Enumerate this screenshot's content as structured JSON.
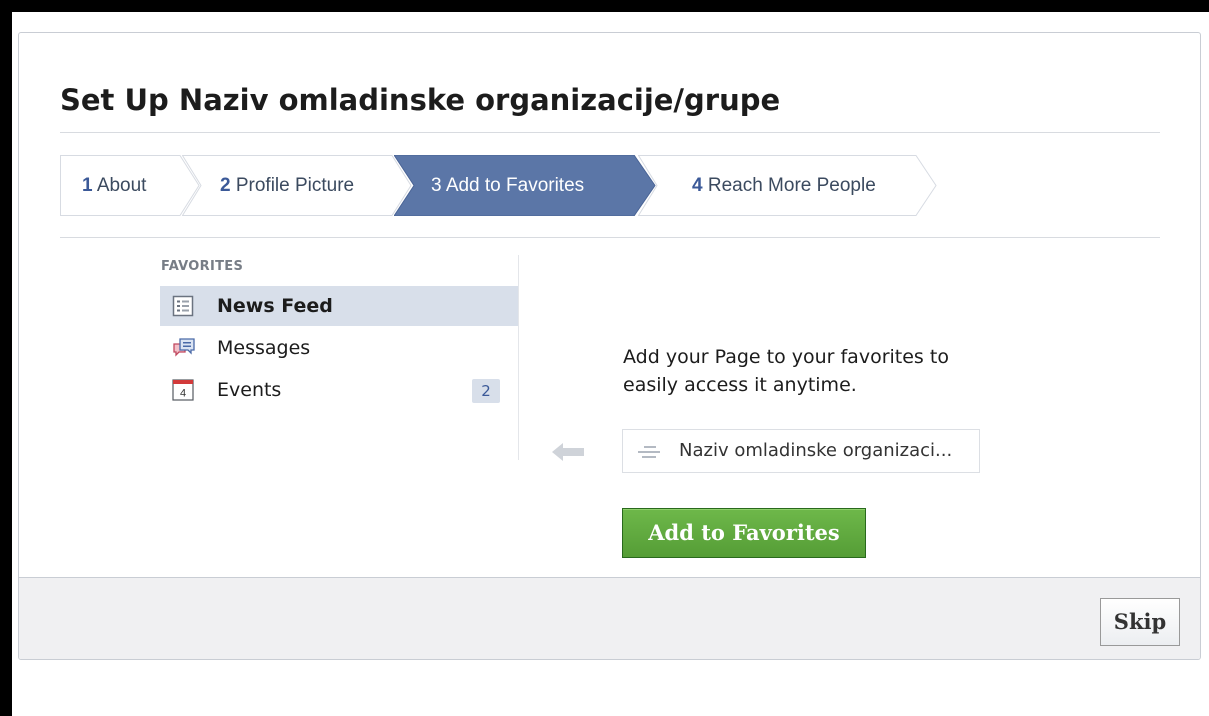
{
  "dialog": {
    "title": "Set Up Naziv omladinske organizacije/grupe"
  },
  "steps": [
    {
      "number": "1",
      "label": "About",
      "active": false
    },
    {
      "number": "2",
      "label": "Profile Picture",
      "active": false
    },
    {
      "number": "3",
      "label": "Add to Favorites",
      "active": true
    },
    {
      "number": "4",
      "label": "Reach More People",
      "active": false
    }
  ],
  "favorites": {
    "heading": "FAVORITES",
    "items": [
      {
        "label": "News Feed",
        "icon": "news-feed-icon",
        "selected": true
      },
      {
        "label": "Messages",
        "icon": "messages-icon",
        "selected": false
      },
      {
        "label": "Events",
        "icon": "calendar-icon",
        "icon_text": "4",
        "count": "2",
        "selected": false
      }
    ]
  },
  "panel": {
    "instructions": "Add your Page to your favorites to easily access it anytime.",
    "page_item_label": "Naziv omladinske organizaci...",
    "add_button": "Add to Favorites"
  },
  "footer": {
    "skip_button": "Skip"
  },
  "colors": {
    "active_step": "#5b76a7",
    "selected_item": "#d8dfea",
    "add_button": "#5ea83c",
    "link_blue": "#3b5998"
  }
}
